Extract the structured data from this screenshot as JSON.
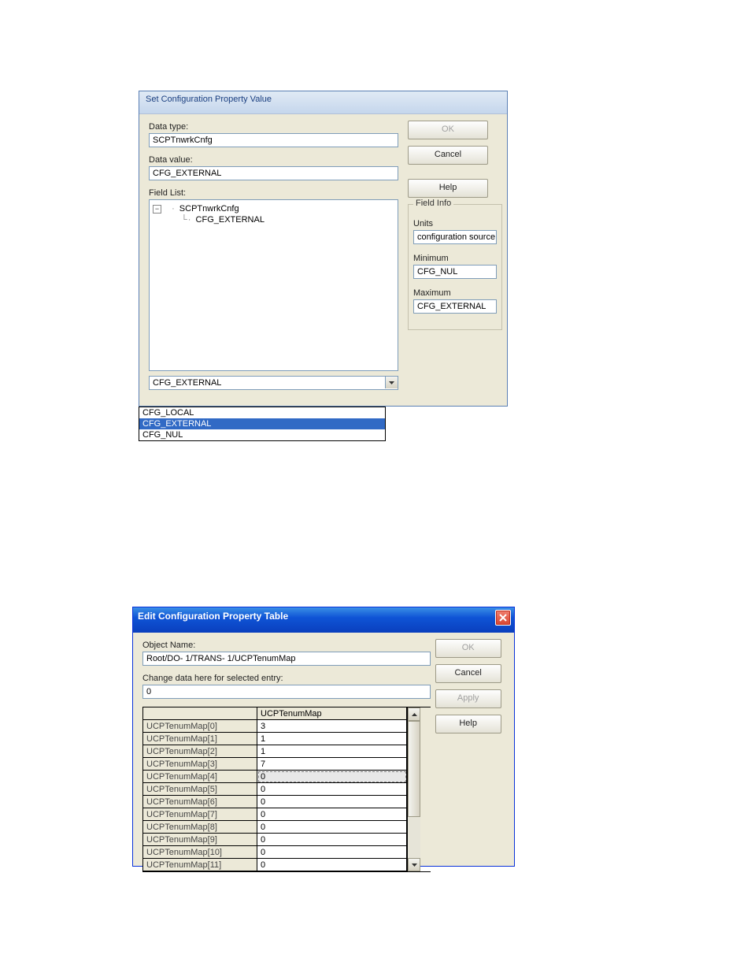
{
  "dlg1": {
    "title": "Set Configuration Property Value",
    "dataType_label": "Data type:",
    "dataType": "SCPTnwrkCnfg",
    "dataValue_label": "Data value:",
    "dataValue": "CFG_EXTERNAL",
    "fieldList_label": "Field List:",
    "tree": {
      "root": "SCPTnwrkCnfg",
      "child": "CFG_EXTERNAL"
    },
    "combo_value": "CFG_EXTERNAL",
    "dropdown_items": [
      "CFG_LOCAL",
      "CFG_EXTERNAL",
      "CFG_NUL"
    ],
    "dropdown_selected_index": 1,
    "buttons": {
      "ok": "OK",
      "cancel": "Cancel",
      "help": "Help"
    },
    "fieldinfo": {
      "legend": "Field Info",
      "units_label": "Units",
      "units": "configuration source na",
      "min_label": "Minimum",
      "min": "CFG_NUL",
      "max_label": "Maximum",
      "max": "CFG_EXTERNAL"
    }
  },
  "dlg2": {
    "title": "Edit Configuration Property Table",
    "objectName_label": "Object Name:",
    "objectName": "Root/DO- 1/TRANS- 1/UCPTenumMap",
    "changeData_label": "Change data here for selected entry:",
    "changeData_value": "0",
    "buttons": {
      "ok": "OK",
      "cancel": "Cancel",
      "apply": "Apply",
      "help": "Help"
    },
    "column_header": "UCPTenumMap",
    "rows": [
      {
        "name": "UCPTenumMap[0]",
        "value": "3"
      },
      {
        "name": "UCPTenumMap[1]",
        "value": "1"
      },
      {
        "name": "UCPTenumMap[2]",
        "value": "1"
      },
      {
        "name": "UCPTenumMap[3]",
        "value": "7"
      },
      {
        "name": "UCPTenumMap[4]",
        "value": "0"
      },
      {
        "name": "UCPTenumMap[5]",
        "value": "0"
      },
      {
        "name": "UCPTenumMap[6]",
        "value": "0"
      },
      {
        "name": "UCPTenumMap[7]",
        "value": "0"
      },
      {
        "name": "UCPTenumMap[8]",
        "value": "0"
      },
      {
        "name": "UCPTenumMap[9]",
        "value": "0"
      },
      {
        "name": "UCPTenumMap[10]",
        "value": "0"
      },
      {
        "name": "UCPTenumMap[11]",
        "value": "0"
      }
    ],
    "selected_row_index": 4
  }
}
